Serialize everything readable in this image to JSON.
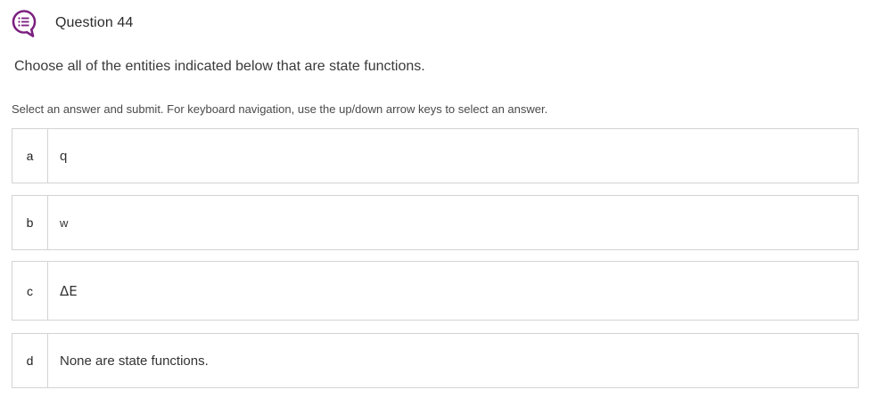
{
  "header": {
    "icon": "question-chat-icon",
    "title": "Question 44",
    "icon_color": "#7a1f7f"
  },
  "question": {
    "prompt": "Choose all of the entities indicated below that are state functions.",
    "instructions": "Select an answer and submit. For keyboard navigation, use the up/down arrow keys to select an answer."
  },
  "options": [
    {
      "letter": "a",
      "text": "q"
    },
    {
      "letter": "b",
      "text": "w"
    },
    {
      "letter": "c",
      "text": "ΔE"
    },
    {
      "letter": "d",
      "text": "None are state functions."
    }
  ]
}
